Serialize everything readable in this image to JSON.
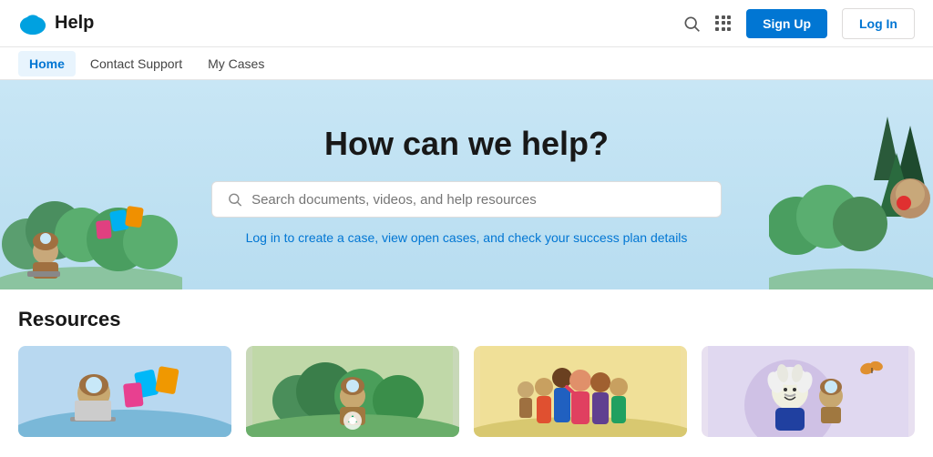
{
  "header": {
    "logo_alt": "Salesforce",
    "title": "Help",
    "search_aria": "Search",
    "grid_aria": "Apps",
    "signup_label": "Sign Up",
    "login_label": "Log In"
  },
  "nav": {
    "items": [
      {
        "label": "Home",
        "active": true
      },
      {
        "label": "Contact Support",
        "active": false
      },
      {
        "label": "My Cases",
        "active": false
      }
    ]
  },
  "hero": {
    "title": "How can we help?",
    "search_placeholder": "Search documents, videos, and help resources",
    "login_prompt": "Log in to create a case, view open cases, and check your success plan details"
  },
  "resources": {
    "section_title": "Resources",
    "cards": [
      {
        "id": 1,
        "color": "#b8d8f0"
      },
      {
        "id": 2,
        "color": "#c8d8b8"
      },
      {
        "id": 3,
        "color": "#f0e0a0"
      },
      {
        "id": 4,
        "color": "#e8e0f0"
      }
    ]
  }
}
